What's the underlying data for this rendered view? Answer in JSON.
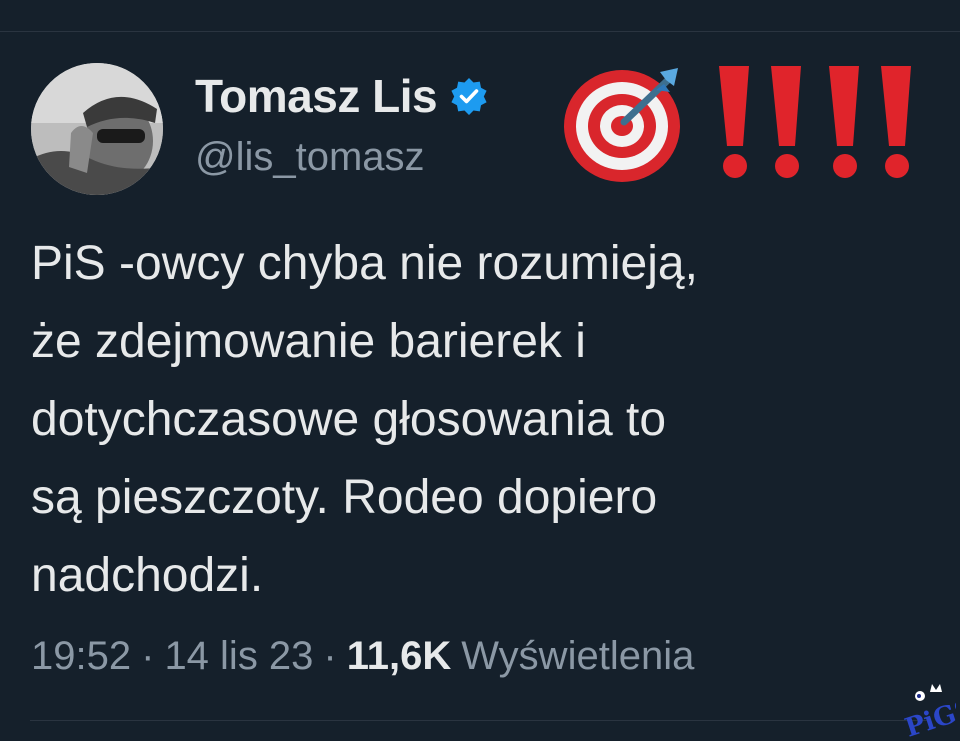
{
  "author": {
    "display_name": "Tomasz Lis",
    "handle": "@lis_tomasz",
    "verified": true
  },
  "reaction_emojis": [
    "target-with-dart",
    "double-exclamation",
    "double-exclamation"
  ],
  "tweet": {
    "lines": [
      "PiS -owcy chyba nie rozumieją,",
      "że zdejmowanie barierek i",
      "dotychczasowe głosowania to",
      "są pieszczoty. Rodeo dopiero",
      "nadchodzi."
    ]
  },
  "meta": {
    "time": "19:52",
    "separator": "·",
    "date": "14 lis 23",
    "views_count": "11,6K",
    "views_label": "Wyświetlenia"
  },
  "watermark": {
    "text": "PiGS"
  },
  "colors": {
    "background": "#15202b",
    "primary_text": "#e7e9ea",
    "secondary_text": "#8b98a5",
    "verified_badge": "#1d9bf0",
    "emoji_red": "#e0242b"
  }
}
